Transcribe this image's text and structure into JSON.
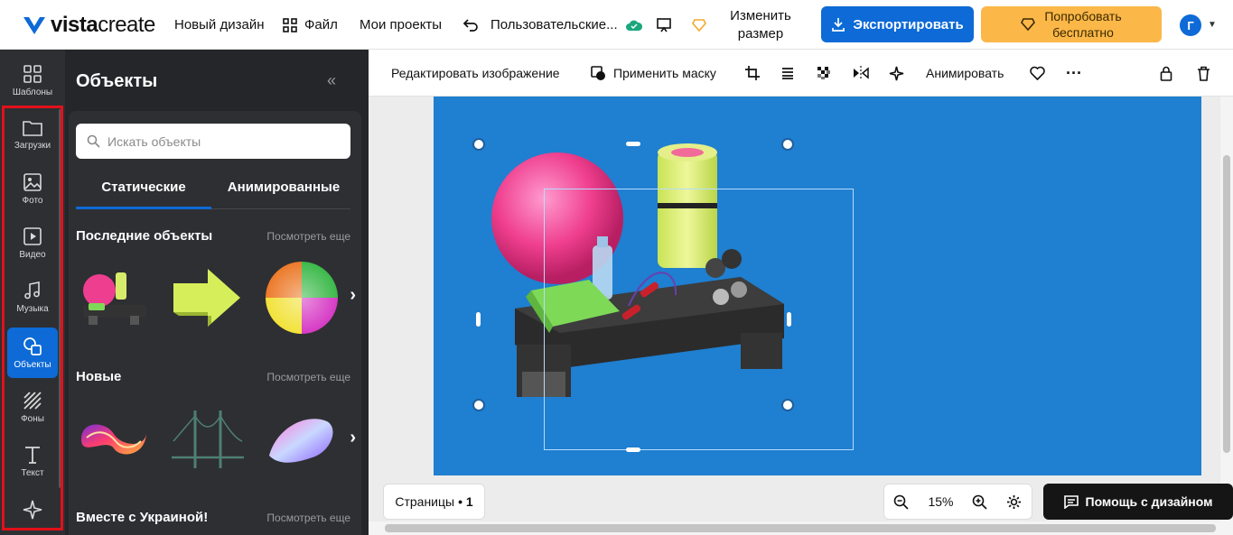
{
  "topbar": {
    "logo_bold": "vista",
    "logo_light": "create",
    "new_design": "Новый дизайн",
    "file": "Файл",
    "my_projects": "Мои проекты",
    "project_name": "Пользовательские...",
    "resize_line1": "Изменить",
    "resize_line2": "размер",
    "export": "Экспортировать",
    "try_line1": "Попробовать",
    "try_line2": "бесплатно",
    "avatar_letter": "Г"
  },
  "rail": {
    "items": [
      {
        "label": "Шаблоны",
        "icon": "templates-icon"
      },
      {
        "label": "Загрузки",
        "icon": "folder-icon"
      },
      {
        "label": "Фото",
        "icon": "image-icon"
      },
      {
        "label": "Видео",
        "icon": "video-icon"
      },
      {
        "label": "Музыка",
        "icon": "music-icon"
      },
      {
        "label": "Объекты",
        "icon": "objects-icon",
        "active": true
      },
      {
        "label": "Фоны",
        "icon": "backgrounds-icon"
      },
      {
        "label": "Текст",
        "icon": "text-icon"
      },
      {
        "label": "",
        "icon": "sparkle-icon"
      }
    ]
  },
  "panel": {
    "title": "Объекты",
    "search_placeholder": "Искать объекты",
    "tab_static": "Статические",
    "tab_animated": "Анимированные",
    "sections": [
      {
        "title": "Последние объекты",
        "more": "Посмотреть еще"
      },
      {
        "title": "Новые",
        "more": "Посмотреть еще"
      },
      {
        "title": "Вместе с Украиной!",
        "more": "Посмотреть еще"
      }
    ]
  },
  "toolbar": {
    "edit_image": "Редактировать изображение",
    "apply_mask": "Применить маску",
    "animate": "Анимировать"
  },
  "footer": {
    "pages_label": "Страницы",
    "pages_count": "• 1",
    "zoom": "15%",
    "help": "Помощь с дизайном"
  },
  "colors": {
    "accent": "#0d6ad6",
    "artboard": "#1f7fd0",
    "try_button": "#fbb748",
    "highlight": "#e2101a"
  }
}
